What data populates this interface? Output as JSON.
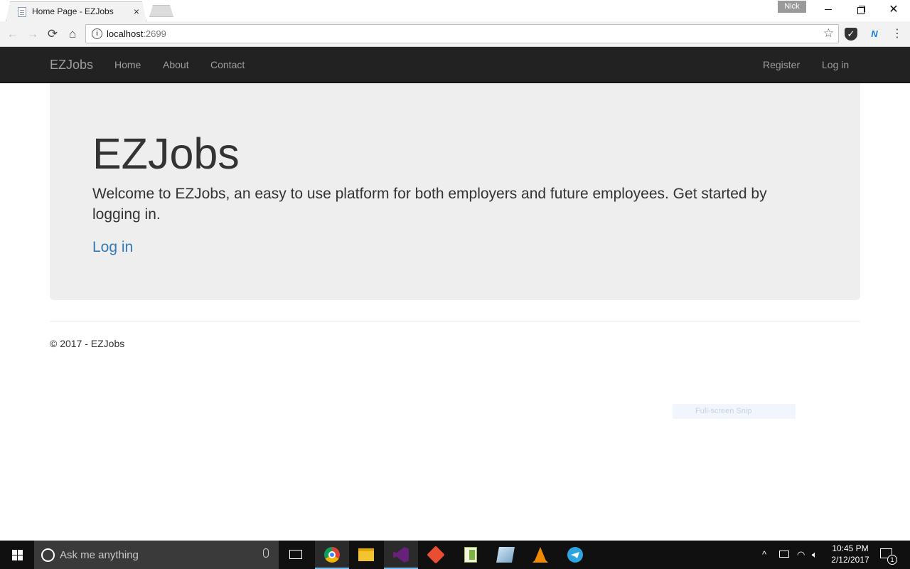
{
  "browser": {
    "tab_title": "Home Page - EZJobs",
    "tab_close": "×",
    "profile_name": "Nick",
    "url_host": "localhost",
    "url_port": ":2699",
    "nav_back": "←",
    "nav_forward": "→",
    "nav_reload": "⟳",
    "nav_home": "⌂",
    "info_glyph": "i",
    "star_glyph": "☆",
    "menu_glyph": "⋮",
    "ext_n_glyph": "N",
    "window_close": "✕"
  },
  "navbar": {
    "brand": "EZJobs",
    "links": [
      "Home",
      "About",
      "Contact"
    ],
    "right_links": [
      "Register",
      "Log in"
    ]
  },
  "jumbotron": {
    "title": "EZJobs",
    "lead": "Welcome to EZJobs, an easy to use platform for both employers and future employees. Get started by logging in.",
    "cta": "Log in"
  },
  "footer": {
    "text": "© 2017 - EZJobs"
  },
  "overlay": {
    "snip_tooltip": "Full-screen Snip"
  },
  "taskbar": {
    "search_placeholder": "Ask me anything",
    "apps": [
      "chrome-icon",
      "file-explorer-icon",
      "visual-studio-icon",
      "git-icon",
      "notepad-plus-icon",
      "windows-app-icon",
      "vlc-icon",
      "telegram-icon"
    ],
    "clock_time": "10:45 PM",
    "clock_date": "2/12/2017",
    "notification_count": "1",
    "accent_color": "#76b9ed"
  },
  "colors": {
    "navbar_bg": "#222222",
    "nav_link": "#9d9d9d",
    "jumbotron_bg": "#eeeeee",
    "link": "#337ab7"
  }
}
